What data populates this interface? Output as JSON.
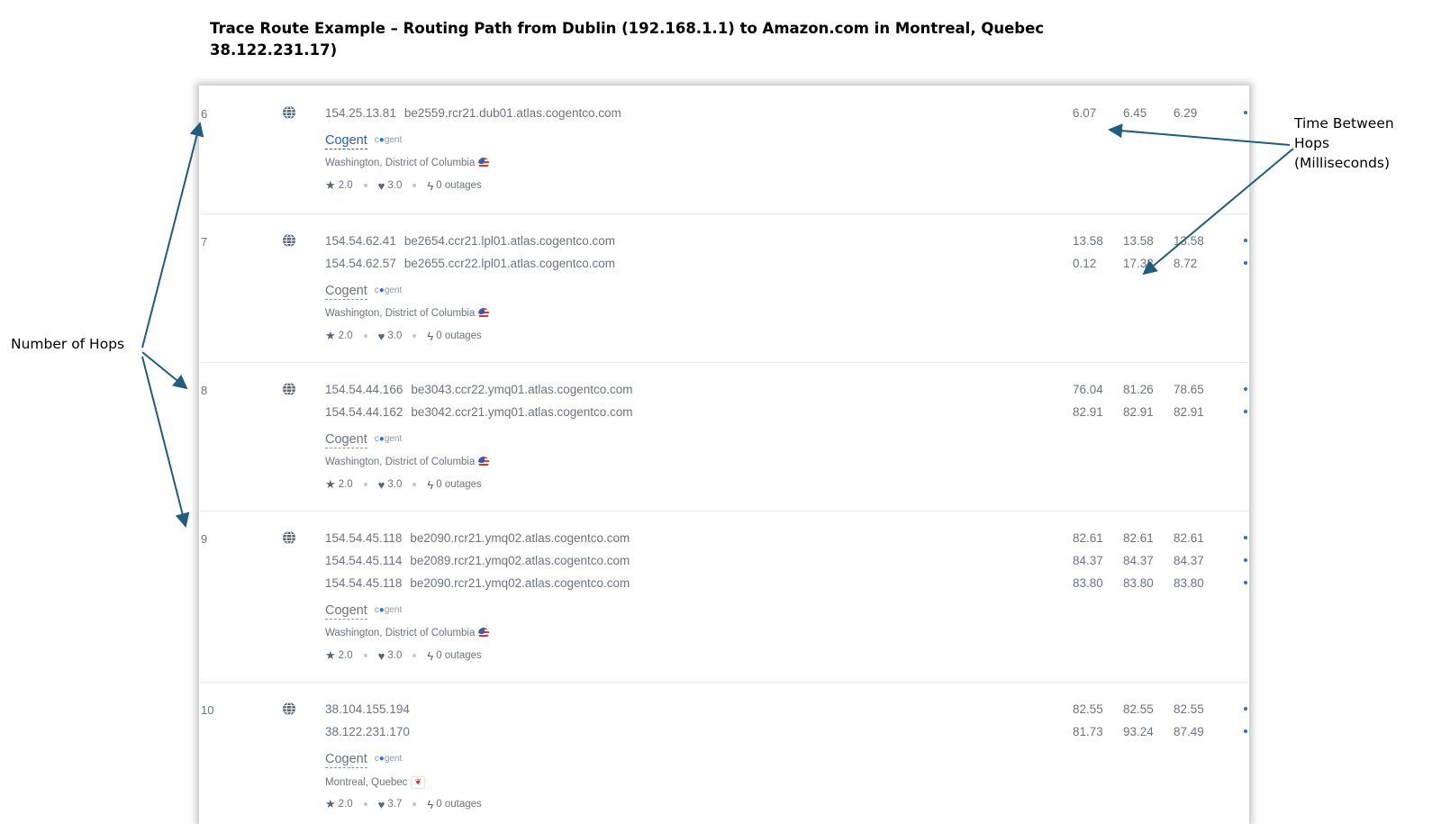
{
  "title": "Trace Route Example – Routing Path from Dublin (192.168.1.1) to Amazon.com in Montreal, Quebec 38.122.231.17)",
  "annotations": {
    "hops_label": "Number of Hops",
    "time_label_1": "Time Between",
    "time_label_2": "Hops",
    "time_label_3": "(Milliseconds)"
  },
  "colors": {
    "accent": "#2a6fdb",
    "arrow": "#1f5d7a",
    "muted_text": "#6b7480"
  },
  "hops": [
    {
      "number": "6",
      "icon": "globe-icon",
      "addresses": [
        {
          "ip": "154.25.13.81",
          "host": "be2559.rcr21.dub01.atlas.cogentco.com",
          "times": [
            "6.07",
            "6.45",
            "6.29"
          ]
        }
      ],
      "provider": "Cogent",
      "provider_logo": "cogent",
      "location": "Washington, District of Columbia",
      "flag": "us",
      "rating": "2.0",
      "likes": "3.0",
      "outages": "0 outages"
    },
    {
      "number": "7",
      "icon": "globe-icon",
      "addresses": [
        {
          "ip": "154.54.62.41",
          "host": "be2654.ccr21.lpl01.atlas.cogentco.com",
          "times": [
            "13.58",
            "13.58",
            "13.58"
          ]
        },
        {
          "ip": "154.54.62.57",
          "host": "be2655.ccr22.lpl01.atlas.cogentco.com",
          "times": [
            "0.12",
            "17.33",
            "8.72"
          ]
        }
      ],
      "provider": "Cogent",
      "provider_logo": "cogent",
      "location": "Washington, District of Columbia",
      "flag": "us",
      "rating": "2.0",
      "likes": "3.0",
      "outages": "0 outages"
    },
    {
      "number": "8",
      "icon": "globe-icon",
      "addresses": [
        {
          "ip": "154.54.44.166",
          "host": "be3043.ccr22.ymq01.atlas.cogentco.com",
          "times": [
            "76.04",
            "81.26",
            "78.65"
          ]
        },
        {
          "ip": "154.54.44.162",
          "host": "be3042.ccr21.ymq01.atlas.cogentco.com",
          "times": [
            "82.91",
            "82.91",
            "82.91"
          ]
        }
      ],
      "provider": "Cogent",
      "provider_logo": "cogent",
      "location": "Washington, District of Columbia",
      "flag": "us",
      "rating": "2.0",
      "likes": "3.0",
      "outages": "0 outages"
    },
    {
      "number": "9",
      "icon": "globe-icon",
      "addresses": [
        {
          "ip": "154.54.45.118",
          "host": "be2090.rcr21.ymq02.atlas.cogentco.com",
          "times": [
            "82.61",
            "82.61",
            "82.61"
          ]
        },
        {
          "ip": "154.54.45.114",
          "host": "be2089.rcr21.ymq02.atlas.cogentco.com",
          "times": [
            "84.37",
            "84.37",
            "84.37"
          ]
        },
        {
          "ip": "154.54.45.118",
          "host": "be2090.rcr21.ymq02.atlas.cogentco.com",
          "times": [
            "83.80",
            "83.80",
            "83.80"
          ]
        }
      ],
      "provider": "Cogent",
      "provider_logo": "cogent",
      "location": "Washington, District of Columbia",
      "flag": "us",
      "rating": "2.0",
      "likes": "3.0",
      "outages": "0 outages"
    },
    {
      "number": "10",
      "icon": "globe-icon",
      "addresses": [
        {
          "ip": "38.104.155.194",
          "host": "",
          "times": [
            "82.55",
            "82.55",
            "82.55"
          ]
        },
        {
          "ip": "38.122.231.170",
          "host": "",
          "times": [
            "81.73",
            "93.24",
            "87.49"
          ]
        }
      ],
      "provider": "Cogent",
      "provider_logo": "cogent",
      "location": "Montreal, Quebec",
      "flag": "ca",
      "rating": "2.0",
      "likes": "3.7",
      "outages": "0 outages"
    }
  ]
}
